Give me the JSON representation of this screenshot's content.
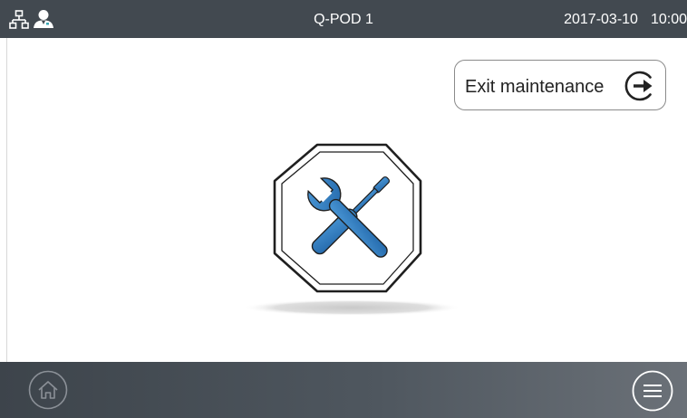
{
  "header": {
    "title": "Q-POD 1",
    "date": "2017-03-10",
    "time": "10:00",
    "icons": [
      "network-icon",
      "user-icon"
    ]
  },
  "main": {
    "exit_button_label": "Exit maintenance",
    "exit_icon": "exit-arrow-icon",
    "status_icon": "maintenance-wrench-screwdriver-icon"
  },
  "footer": {
    "home_icon": "home-icon",
    "menu_icon": "menu-icon"
  },
  "colors": {
    "header_background": "#424950",
    "footer_background": "#4f575f",
    "tool_blue": "#2f7fc4",
    "text_dark": "#222222"
  }
}
